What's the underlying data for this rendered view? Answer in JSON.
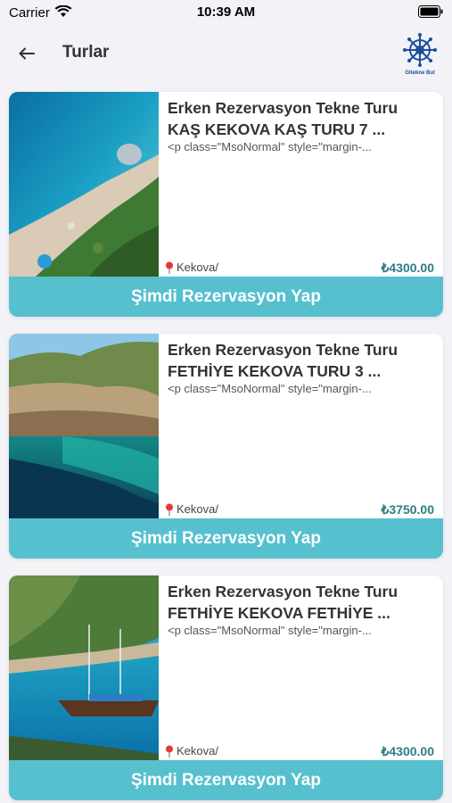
{
  "status_bar": {
    "carrier": "Carrier",
    "time": "10:39 AM"
  },
  "nav": {
    "title": "Turlar",
    "logo_text": "Gitekne Bul"
  },
  "colors": {
    "accent": "#56c0cf",
    "price": "#2e7c86",
    "pin": "#e53935"
  },
  "tours": [
    {
      "title_line1": "Erken Rezervasyon Tekne Turu",
      "title_line2": "KAŞ KEKOVA KAŞ TURU 7 ...",
      "description": "<p class=\"MsoNormal\" style=\"margin-...",
      "location": "Kekova/",
      "price": "₺4300.00",
      "button_label": "Şimdi Rezervasyon Yap"
    },
    {
      "title_line1": "Erken Rezervasyon Tekne Turu",
      "title_line2": "FETHİYE KEKOVA TURU 3 ...",
      "description": "<p class=\"MsoNormal\" style=\"margin-...",
      "location": "Kekova/",
      "price": "₺3750.00",
      "button_label": "Şimdi Rezervasyon Yap"
    },
    {
      "title_line1": "Erken Rezervasyon Tekne Turu",
      "title_line2": "FETHİYE KEKOVA FETHİYE ...",
      "description": "<p class=\"MsoNormal\" style=\"margin-...",
      "location": "Kekova/",
      "price": "₺4300.00",
      "button_label": "Şimdi Rezervasyon Yap"
    }
  ]
}
